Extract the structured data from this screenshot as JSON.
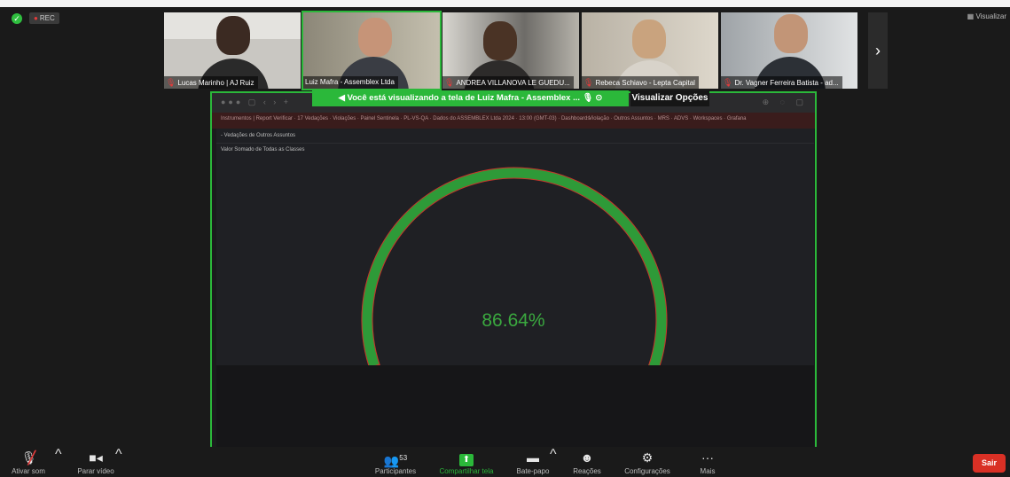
{
  "meeting": {
    "rec_label": "REC",
    "view_label": "Visualizar"
  },
  "participants": [
    {
      "name": "Lucas Marinho | AJ Ruiz",
      "muted": true
    },
    {
      "name": "Luiz Mafra - Assemblex Ltda",
      "muted": false
    },
    {
      "name": "ANDREA VILLANOVA LE GUEDU...",
      "muted": true
    },
    {
      "name": "Rebeca Schiavo - Lepta Capital",
      "muted": true
    },
    {
      "name": "Dr. Vagner Ferreira Batista - ad...",
      "muted": true
    }
  ],
  "share_banner": {
    "text": "Você está visualizando a tela de  Luiz Mafra - Assemblex ...",
    "options_label": "Visualizar Opções"
  },
  "shared_screen": {
    "url_text": "Instrumentos | Report Verificar · 17 Vedações · Violações · Painel Sentinela · PL-VS-QA · Dados do ASSEMBLEX Ltda 2024 · 13:00 (GMT-03) · Dashboards",
    "url_right": "Violação · Outros Assuntos · MRS · ADVS · Workspaces · Grafana",
    "panel_title": "- Vedações de Outros Assuntos",
    "panel_subtitle": "Valor Somado de Todas as Classes",
    "gauge": {
      "value": 86.64,
      "display": "86.64%",
      "color": "#2e9a38",
      "accent": "#c8352b"
    }
  },
  "toolbar": {
    "mute": "Ativar som",
    "video": "Parar vídeo",
    "participants": "Participantes",
    "participants_count": "53",
    "share": "Compartilhar tela",
    "chat": "Bate-papo",
    "reactions": "Reações",
    "settings": "Configurações",
    "more": "Mais",
    "leave": "Sair"
  }
}
